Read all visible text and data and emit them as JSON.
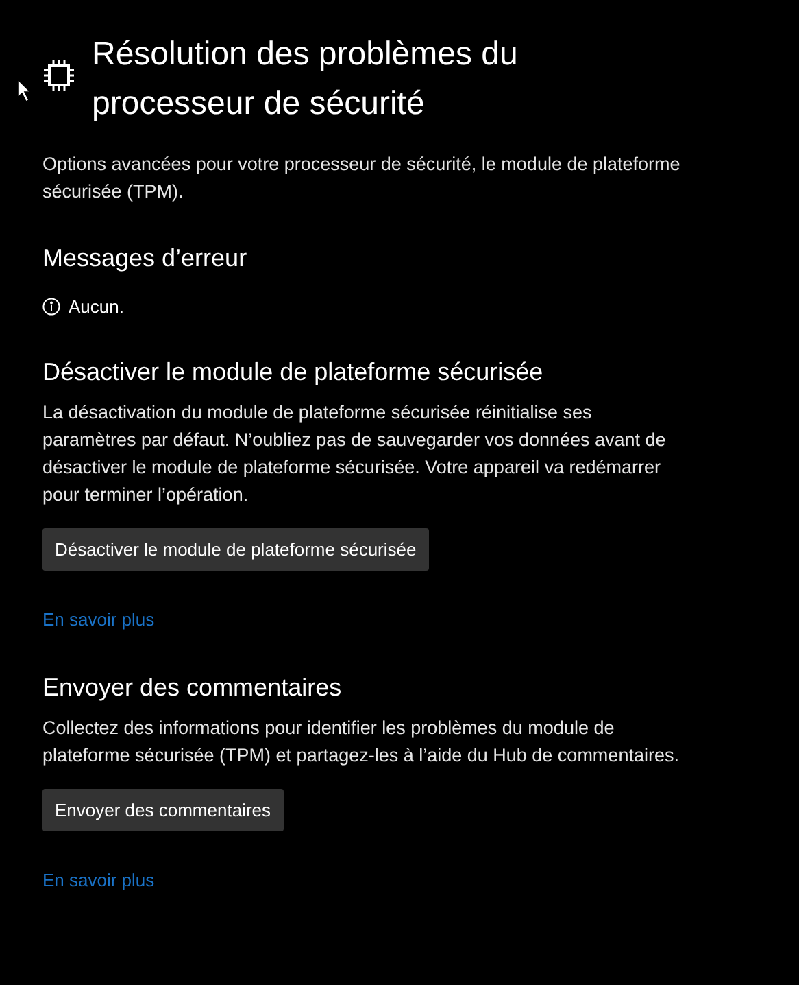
{
  "header": {
    "title": "Résolution des problèmes du processeur de sécurité",
    "description": "Options avancées pour votre processeur de sécurité, le module de plateforme sécurisée (TPM)."
  },
  "error_messages": {
    "heading": "Messages d’erreur",
    "items": [
      "Aucun."
    ]
  },
  "sections": [
    {
      "heading": "Désactiver le module de plateforme sécurisée",
      "text": "La désactivation du module de plateforme sécurisée réinitialise ses paramètres par défaut. N’oubliez pas de sauvegarder vos données avant de désactiver le module de plateforme sécurisée. Votre appareil va redémarrer pour terminer l’opération.",
      "button": "Désactiver le module de plateforme sécurisée",
      "link": "En savoir plus"
    },
    {
      "heading": "Envoyer des commentaires",
      "text": "Collectez des informations pour identifier les problèmes du module de plateforme sécurisée (TPM) et partagez-les à l’aide du Hub de commentaires.",
      "button": "Envoyer des commentaires",
      "link": "En savoir plus"
    }
  ]
}
